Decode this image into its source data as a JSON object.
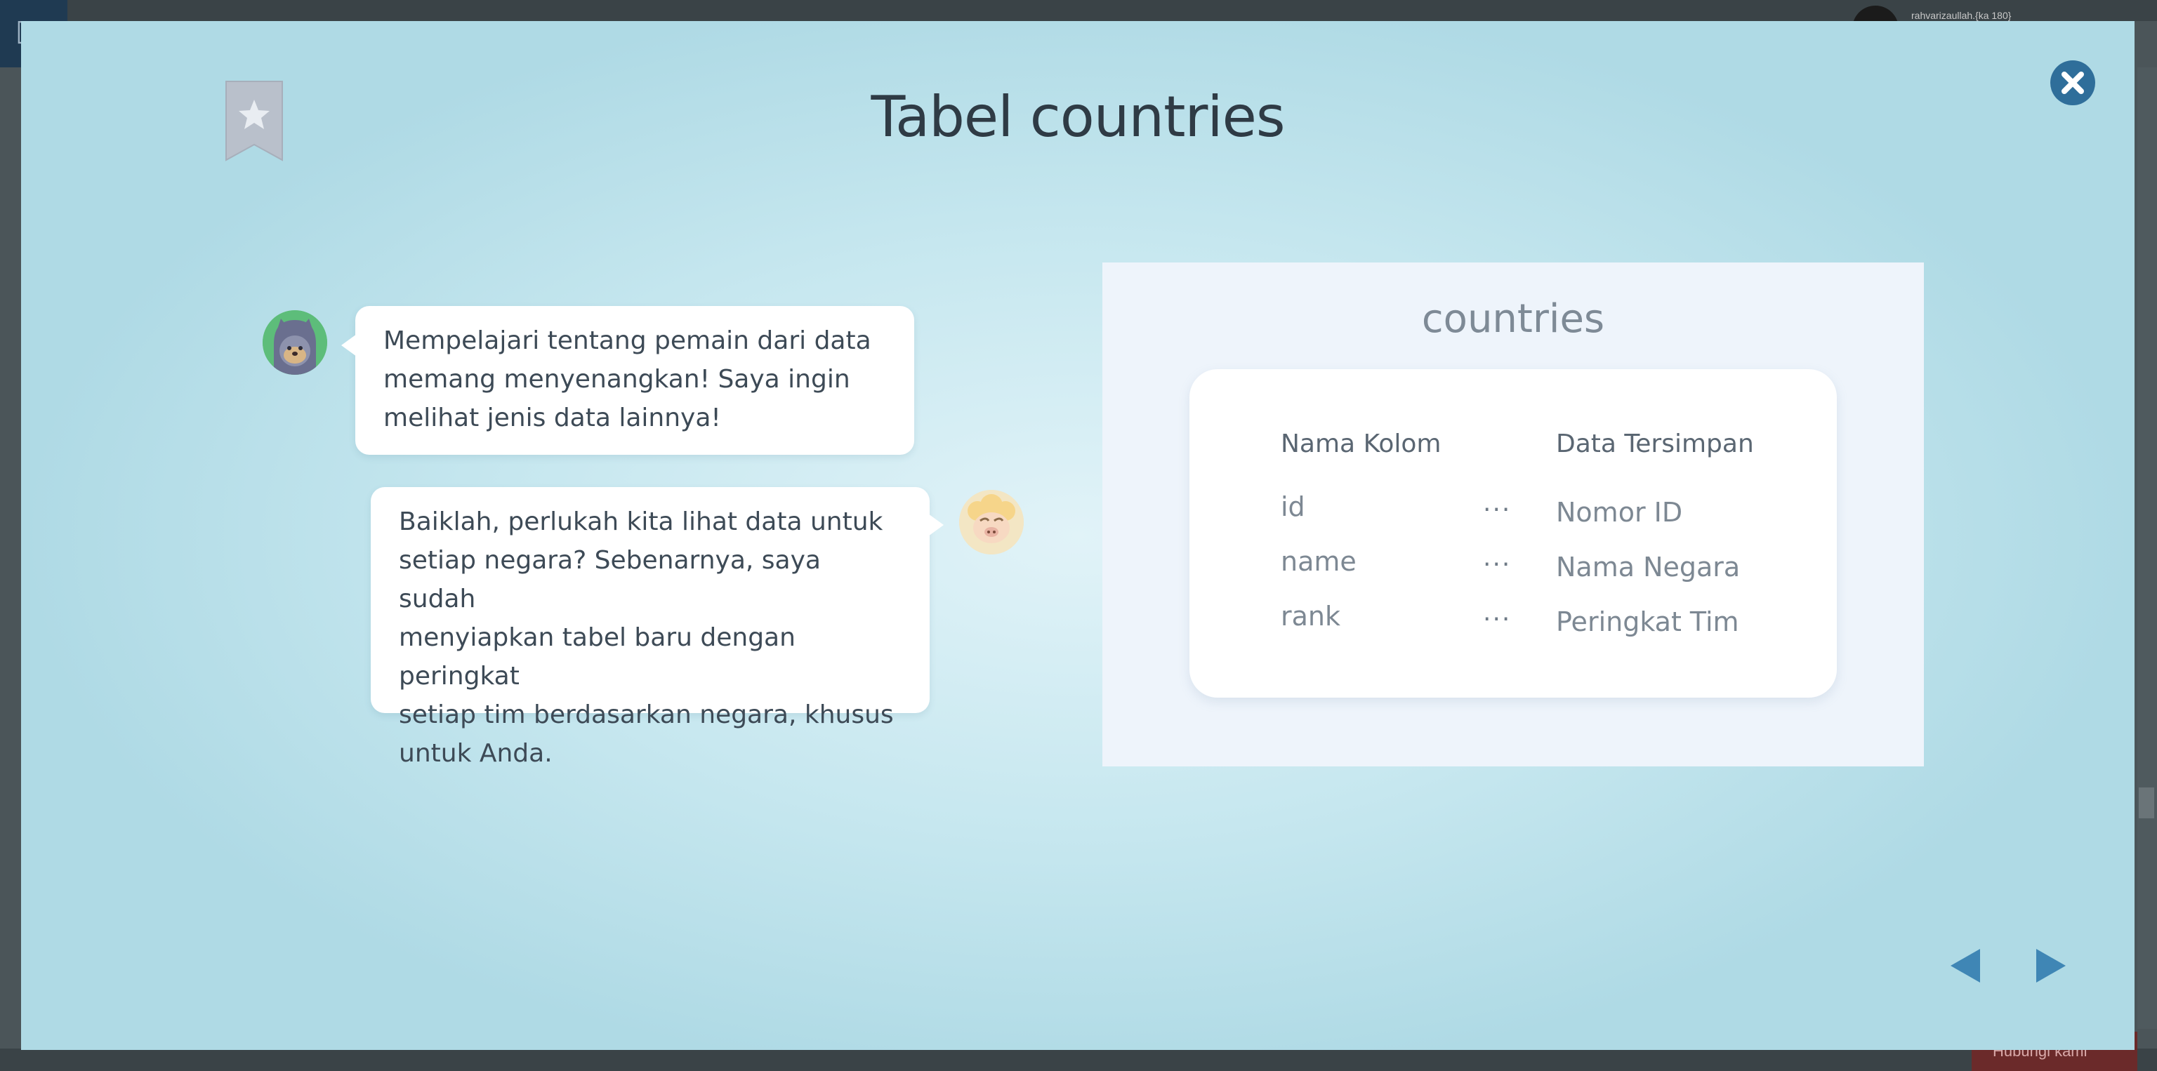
{
  "background": {
    "user_label": "rahvarizaullah.{ka 180}",
    "bottom_button_label": "Hubungi kami"
  },
  "modal": {
    "title": "Tabel countries",
    "bookmark_icon": "star-bookmark-icon",
    "close_icon": "close-icon"
  },
  "chat": {
    "messages": [
      {
        "speaker_icon": "cat-avatar-icon",
        "lines": [
          "Mempelajari tentang pemain dari data",
          "memang menyenangkan! Saya ingin",
          "melihat jenis data lainnya!"
        ]
      },
      {
        "speaker_icon": "sheep-avatar-icon",
        "lines": [
          "Baiklah, perlukah kita lihat data untuk",
          "setiap negara? Sebenarnya, saya sudah",
          "menyiapkan tabel baru dengan peringkat",
          "setiap tim berdasarkan negara, khusus",
          "untuk Anda."
        ]
      }
    ]
  },
  "table_panel": {
    "title": "countries",
    "headers": {
      "column": "Nama Kolom",
      "data": "Data Tersimpan"
    },
    "rows": [
      {
        "name": "id",
        "sep": "···",
        "value": "Nomor ID"
      },
      {
        "name": "name",
        "sep": "···",
        "value": "Nama Negara"
      },
      {
        "name": "rank",
        "sep": "···",
        "value": "Peringkat Tim"
      }
    ]
  },
  "nav": {
    "prev_icon": "triangle-left-icon",
    "next_icon": "triangle-right-icon"
  },
  "colors": {
    "accent": "#2f6e9a",
    "modal_bg": "#c6e7ef",
    "nav_arrow": "#3f86b5"
  }
}
